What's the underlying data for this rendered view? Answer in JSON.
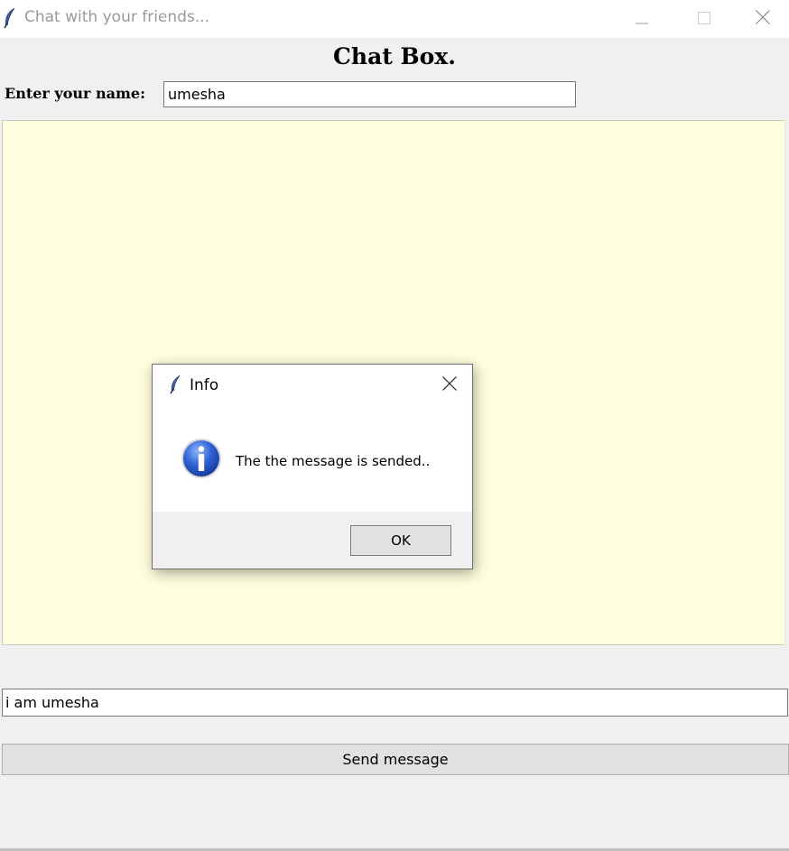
{
  "window": {
    "title": "Chat with your friends...",
    "icon": "feather-icon",
    "controls": [
      "minimize-icon",
      "maximize-icon",
      "close-icon"
    ]
  },
  "main": {
    "heading": "Chat Box.",
    "name_label": "Enter your name:",
    "name_value": "umesha",
    "chat_background": "#fffedd",
    "message_value": "i am umesha",
    "send_label": "Send message"
  },
  "dialog": {
    "title": "Info",
    "icon": "info-icon",
    "message": "The the message is sended..",
    "ok_label": "OK"
  }
}
